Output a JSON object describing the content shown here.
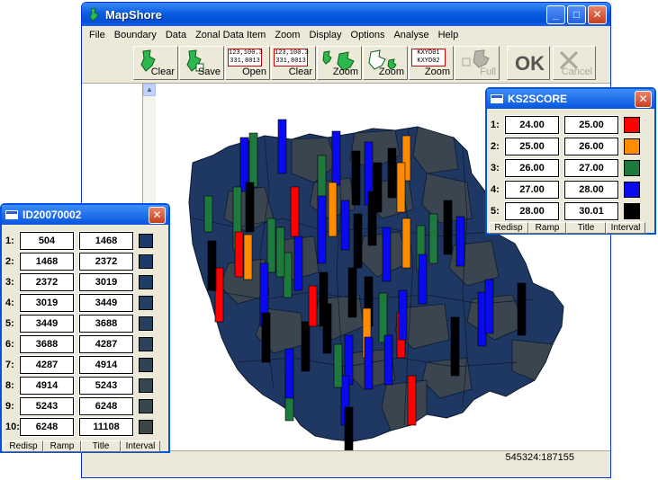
{
  "app": {
    "title": "MapShore"
  },
  "window_controls": {
    "minimize": "_",
    "maximize": "□",
    "close": "✕"
  },
  "menu": [
    "File",
    "Boundary",
    "Data",
    "Zonal Data Item",
    "Zoom",
    "Display",
    "Options",
    "Analyse",
    "Help"
  ],
  "toolbar": {
    "buttons": [
      {
        "label": "Clear",
        "icon": "map-clear-icon",
        "enabled": true
      },
      {
        "label": "Save",
        "icon": "map-save-icon",
        "enabled": true
      },
      {
        "label": "Open",
        "icon": "coord-open-icon",
        "coords": [
          "123,100.3",
          "331,8013"
        ],
        "enabled": true
      },
      {
        "label": "Clear",
        "icon": "coord-clear-icon",
        "coords": [
          "123,100.3",
          "331,8013"
        ],
        "enabled": true
      },
      {
        "label": "Zoom",
        "icon": "zoom-in-map-icon",
        "enabled": true
      },
      {
        "label": "Zoom",
        "icon": "zoom-out-map-icon",
        "enabled": true
      },
      {
        "label": "Zoom",
        "icon": "zoom-coords-icon",
        "coords": [
          "KXYD01",
          "KXYD02"
        ],
        "enabled": true
      },
      {
        "label": "Full",
        "icon": "full-extent-icon",
        "enabled": false
      },
      {
        "label": "OK",
        "icon": "ok-icon",
        "enabled": true
      },
      {
        "label": "Cancel",
        "icon": "cancel-icon",
        "enabled": false
      }
    ]
  },
  "status": {
    "coordinates": "545324:187155"
  },
  "legend_ks2": {
    "title": "KS2SCORE",
    "rows": [
      {
        "index": "1:",
        "from": "24.00",
        "to": "25.00",
        "color": "#ff0000"
      },
      {
        "index": "2:",
        "from": "25.00",
        "to": "26.00",
        "color": "#ff8c00"
      },
      {
        "index": "3:",
        "from": "26.00",
        "to": "27.00",
        "color": "#1e7a3c"
      },
      {
        "index": "4:",
        "from": "27.00",
        "to": "28.00",
        "color": "#0a0af0"
      },
      {
        "index": "5:",
        "from": "28.00",
        "to": "30.01",
        "color": "#000000"
      }
    ],
    "buttons": [
      "Redisp",
      "Ramp",
      "Title",
      "Interval"
    ]
  },
  "legend_id": {
    "title": "ID20070002",
    "rows": [
      {
        "index": "1:",
        "from": "504",
        "to": "1468",
        "color": "#1b3a6b"
      },
      {
        "index": "2:",
        "from": "1468",
        "to": "2372",
        "color": "#1d3b69"
      },
      {
        "index": "3:",
        "from": "2372",
        "to": "3019",
        "color": "#203d66"
      },
      {
        "index": "4:",
        "from": "3019",
        "to": "3449",
        "color": "#233f63"
      },
      {
        "index": "5:",
        "from": "3449",
        "to": "3688",
        "color": "#26405f"
      },
      {
        "index": "6:",
        "from": "3688",
        "to": "4287",
        "color": "#2a425b"
      },
      {
        "index": "7:",
        "from": "4287",
        "to": "4914",
        "color": "#2e4456"
      },
      {
        "index": "8:",
        "from": "4914",
        "to": "5243",
        "color": "#334651"
      },
      {
        "index": "9:",
        "from": "5243",
        "to": "6248",
        "color": "#37474c"
      },
      {
        "index": "10:",
        "from": "6248",
        "to": "11108",
        "color": "#3c4647"
      }
    ],
    "buttons": [
      "Redisp",
      "Ramp",
      "Title",
      "Interval"
    ]
  },
  "map": {
    "base_colors": {
      "dark_navy": "#1e3763",
      "slate": "#3a4550",
      "mid": "#28405c",
      "outline": "#0d1a30"
    }
  }
}
